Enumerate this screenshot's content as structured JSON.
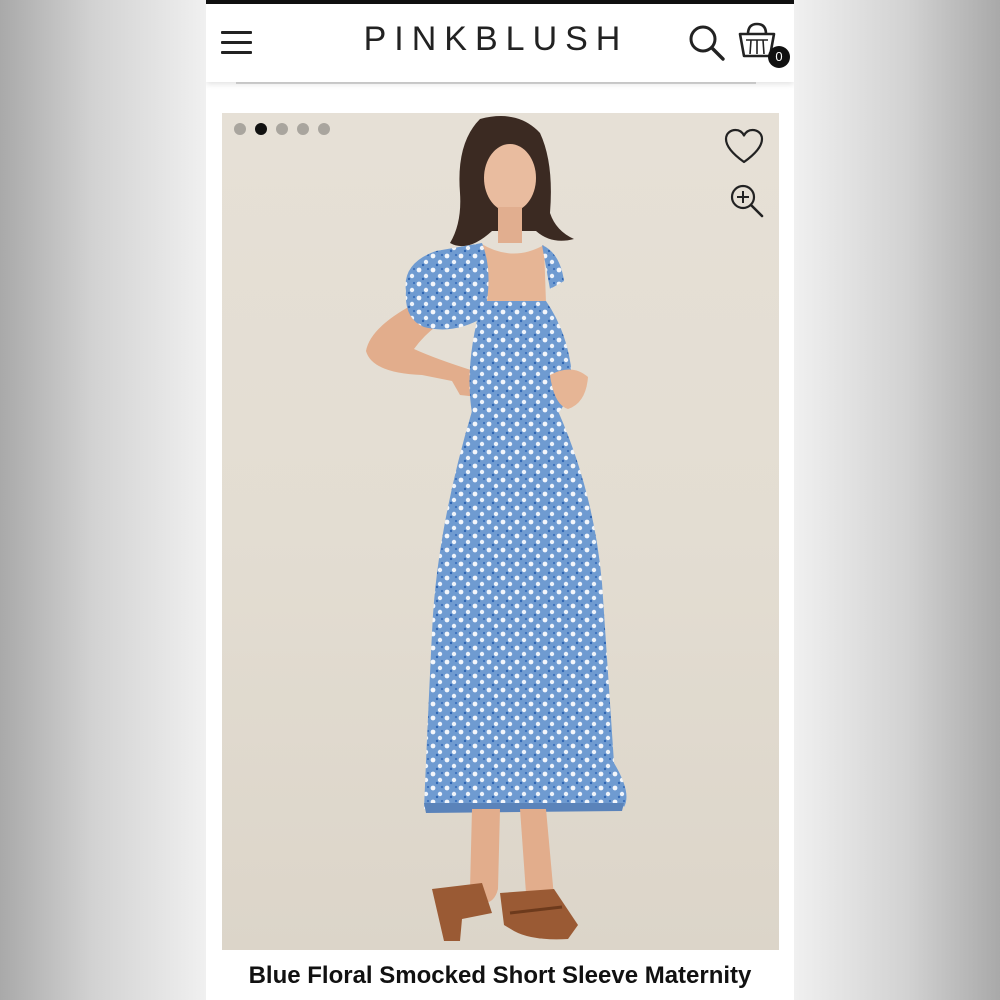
{
  "brand": {
    "logo_text": "PINKBLUSH"
  },
  "header": {
    "menu_icon": "hamburger-menu-icon",
    "search_icon": "search-icon",
    "cart_icon": "shopping-bag-icon",
    "cart_count": "0"
  },
  "gallery": {
    "dot_count": 5,
    "active_index": 1,
    "favorite_icon": "heart-outline-icon",
    "zoom_icon": "zoom-in-icon"
  },
  "product": {
    "title": "Blue Floral Smocked Short Sleeve Maternity"
  },
  "colors": {
    "dress_blue": "#6f9bd1",
    "background_beige": "#e3ddd2",
    "sandal_brown": "#9a5a34"
  }
}
